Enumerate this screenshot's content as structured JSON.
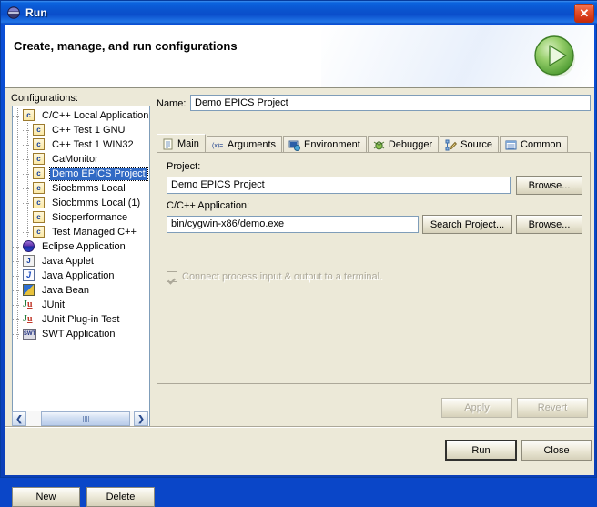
{
  "window": {
    "title": "Run",
    "title_icon": "eclipse-run-icon",
    "close_label": "✕"
  },
  "banner": {
    "title": "Create, manage, and run configurations",
    "icon": "run-play-icon"
  },
  "configurations": {
    "label": "Configurations:",
    "tree": [
      {
        "label": "C/C++ Local Application",
        "icon": "c-config-icon",
        "depth": 0,
        "selected": false
      },
      {
        "label": "C++ Test 1 GNU",
        "icon": "c-config-icon",
        "depth": 1,
        "selected": false
      },
      {
        "label": "C++ Test 1 WIN32",
        "icon": "c-config-icon",
        "depth": 1,
        "selected": false
      },
      {
        "label": "CaMonitor",
        "icon": "c-config-icon",
        "depth": 1,
        "selected": false
      },
      {
        "label": "Demo EPICS Project",
        "icon": "c-config-icon",
        "depth": 1,
        "selected": true
      },
      {
        "label": "Siocbmms Local",
        "icon": "c-config-icon",
        "depth": 1,
        "selected": false
      },
      {
        "label": "Siocbmms Local (1)",
        "icon": "c-config-icon",
        "depth": 1,
        "selected": false
      },
      {
        "label": "Siocperformance",
        "icon": "c-config-icon",
        "depth": 1,
        "selected": false
      },
      {
        "label": "Test Managed C++",
        "icon": "c-config-icon",
        "depth": 1,
        "selected": false
      },
      {
        "label": "Eclipse Application",
        "icon": "eclipse-icon",
        "depth": 0,
        "selected": false
      },
      {
        "label": "Java Applet",
        "icon": "java-applet-icon",
        "depth": 0,
        "selected": false
      },
      {
        "label": "Java Application",
        "icon": "java-application-icon",
        "depth": 0,
        "selected": false
      },
      {
        "label": "Java Bean",
        "icon": "java-bean-icon",
        "depth": 0,
        "selected": false
      },
      {
        "label": "JUnit",
        "icon": "junit-icon",
        "depth": 0,
        "selected": false
      },
      {
        "label": "JUnit Plug-in Test",
        "icon": "junit-plugin-icon",
        "depth": 0,
        "selected": false
      },
      {
        "label": "SWT Application",
        "icon": "swt-icon",
        "depth": 0,
        "selected": false
      }
    ],
    "scrollbar": {
      "left_arrow": "❮",
      "right_arrow": "❯"
    },
    "new_label": "New",
    "delete_label": "Delete"
  },
  "details": {
    "name_label": "Name:",
    "name_value": "Demo EPICS Project",
    "tabs": [
      {
        "label": "Main",
        "icon": "document-icon",
        "active": true
      },
      {
        "label": "Arguments",
        "icon": "variable-icon",
        "active": false
      },
      {
        "label": "Environment",
        "icon": "environment-icon",
        "active": false
      },
      {
        "label": "Debugger",
        "icon": "bug-icon",
        "active": false
      },
      {
        "label": "Source",
        "icon": "source-pencil-icon",
        "active": false
      },
      {
        "label": "Common",
        "icon": "common-list-icon",
        "active": false
      }
    ],
    "project_label": "Project:",
    "project_value": "Demo EPICS Project",
    "project_browse_label": "Browse...",
    "application_label": "C/C++ Application:",
    "application_value": "bin/cygwin-x86/demo.exe",
    "search_project_label": "Search Project...",
    "application_browse_label": "Browse...",
    "terminal_checkbox_label": "Connect process input & output to a terminal.",
    "terminal_checkbox_checked": true,
    "terminal_checkbox_enabled": false,
    "apply_label": "Apply",
    "revert_label": "Revert"
  },
  "footer": {
    "run_label": "Run",
    "close_label": "Close"
  },
  "colors": {
    "titlebar": "#0A4ECB",
    "dialog_bg": "#ECE9D8",
    "selection": "#316AC5",
    "field_border": "#7F9DB9",
    "disabled_text": "#ACA899",
    "accent_green": "#6FBF3F",
    "close_red": "#C8290A"
  }
}
